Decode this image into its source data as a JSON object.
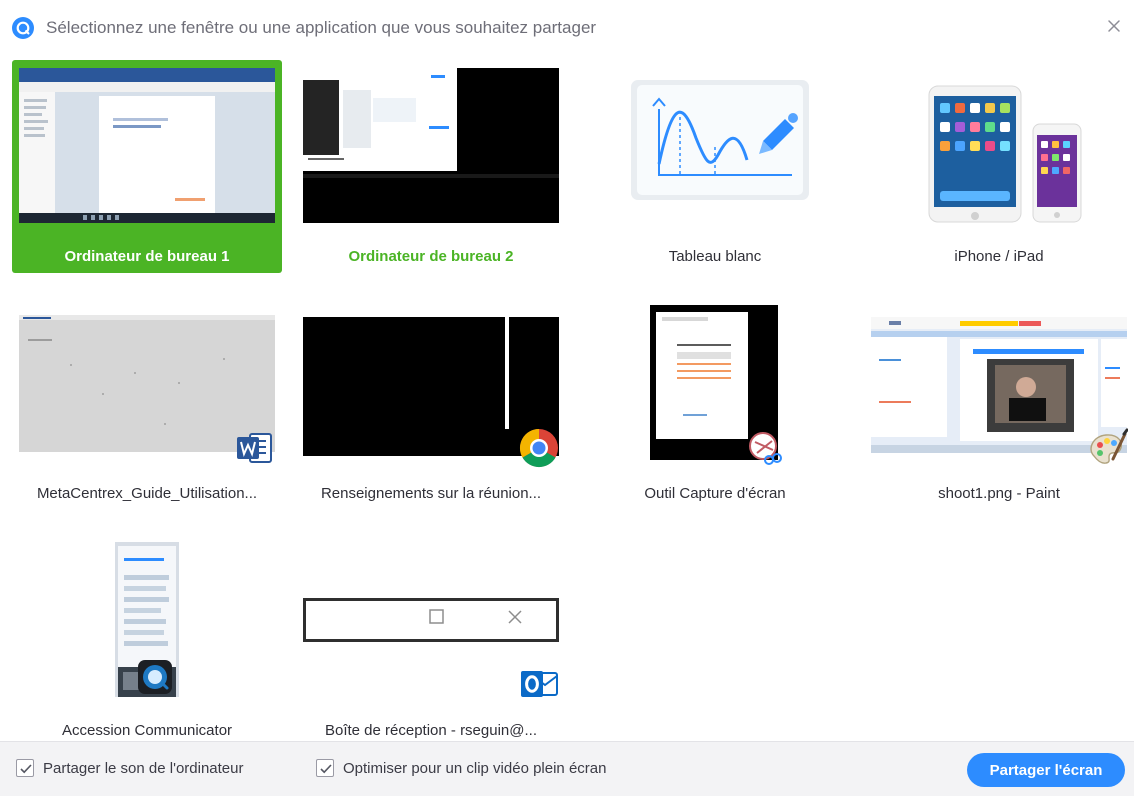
{
  "dialog": {
    "title": "Sélectionnez une fenêtre ou une application que vous souhaitez partager",
    "close_icon": "close-icon",
    "app_icon": "zoom-icon"
  },
  "items": [
    {
      "label": "Ordinateur de bureau 1",
      "selected": true,
      "thumbnail": "desktop-screen-thumbnail"
    },
    {
      "label": "Ordinateur de bureau 2",
      "selected": false,
      "thumbnail": "desktop-screen-thumbnail"
    },
    {
      "label": "Tableau blanc",
      "selected": false,
      "thumbnail": "whiteboard-icon"
    },
    {
      "label": "iPhone / iPad",
      "selected": false,
      "thumbnail": "iphone-ipad-icon"
    },
    {
      "label": "MetaCentrex_Guide_Utilisation...",
      "selected": false,
      "thumbnail": "word-document-thumbnail",
      "badge": "word-icon"
    },
    {
      "label": "Renseignements sur la réunion...",
      "selected": false,
      "thumbnail": "black-window-thumbnail",
      "badge": "chrome-icon"
    },
    {
      "label": "Outil Capture d'écran",
      "selected": false,
      "thumbnail": "snipping-tool-thumbnail",
      "badge": "scissors-icon"
    },
    {
      "label": "shoot1.png - Paint",
      "selected": false,
      "thumbnail": "paint-thumbnail",
      "badge": "paint-palette-icon"
    },
    {
      "label": "Accession Communicator",
      "selected": false,
      "thumbnail": "communicator-thumbnail",
      "badge": "communicator-icon"
    },
    {
      "label": "Boîte de réception - rseguin@...",
      "selected": false,
      "thumbnail": "outlook-window-thumbnail",
      "badge": "outlook-icon"
    }
  ],
  "footer": {
    "share_sound_label": "Partager le son de l'ordinateur",
    "share_sound_checked": true,
    "optimize_video_label": "Optimiser pour un clip vidéo plein écran",
    "optimize_video_checked": true,
    "share_button_label": "Partager l'écran"
  },
  "colors": {
    "accent_blue": "#2d8cff",
    "selected_green": "#4bb425",
    "title_gray": "#6e6e78",
    "footer_bg": "#f3f3f5"
  }
}
